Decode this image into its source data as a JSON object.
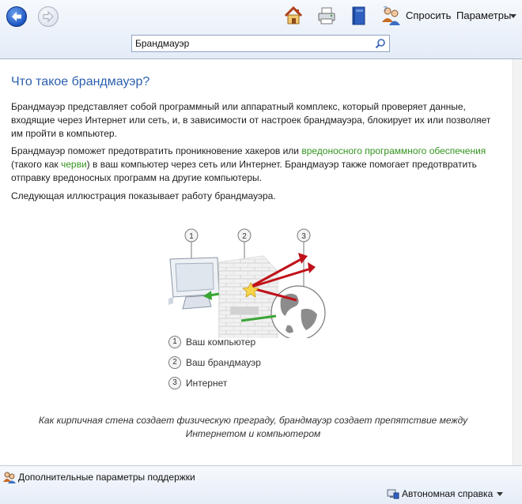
{
  "window": {
    "search_value": "Брандмауэр"
  },
  "toolbar": {
    "ask_label": "Спросить",
    "options_label": "Параметры",
    "icons": [
      "back-icon",
      "forward-icon",
      "home-icon",
      "print-icon",
      "browse-help-icon",
      "ask-icon",
      "search-icon"
    ]
  },
  "article": {
    "title": "Что такое брандмауэр?",
    "p1": "Брандмауэр представляет собой программный или аппаратный комплекс, который проверяет данные, входящие через Интернет или сеть, и, в зависимости от настроек брандмауэра, блокирует их или позволяет им пройти в компьютер.",
    "p2_part1": "Брандмауэр поможет предотвратить проникновение хакеров или ",
    "p2_link1": "вредоносного программного обеспечения",
    "p2_part2": " (такого как ",
    "p2_link2": "черви",
    "p2_part3": ") в ваш компьютер через сеть или Интернет. Брандмауэр также помогает предотвратить отправку вредоносных программ на другие компьютеры.",
    "p3": "Следующая иллюстрация показывает работу брандмауэра.",
    "illustration_numbers": [
      "1",
      "2",
      "3"
    ],
    "legend": [
      {
        "num": "1",
        "label": "Ваш компьютер"
      },
      {
        "num": "2",
        "label": "Ваш брандмауэр"
      },
      {
        "num": "3",
        "label": "Интернет"
      }
    ],
    "caption": "Как кирпичная стена создает физическую преграду, брандмауэр создает препятствие между Интернетом и компьютером"
  },
  "footer": {
    "support_label": "Дополнительные параметры поддержки",
    "offline_label": "Автономная справка"
  },
  "colors": {
    "title": "#2b5fad",
    "link": "#33941f",
    "arrow_red": "#c0121a",
    "arrow_green": "#3aa535"
  }
}
